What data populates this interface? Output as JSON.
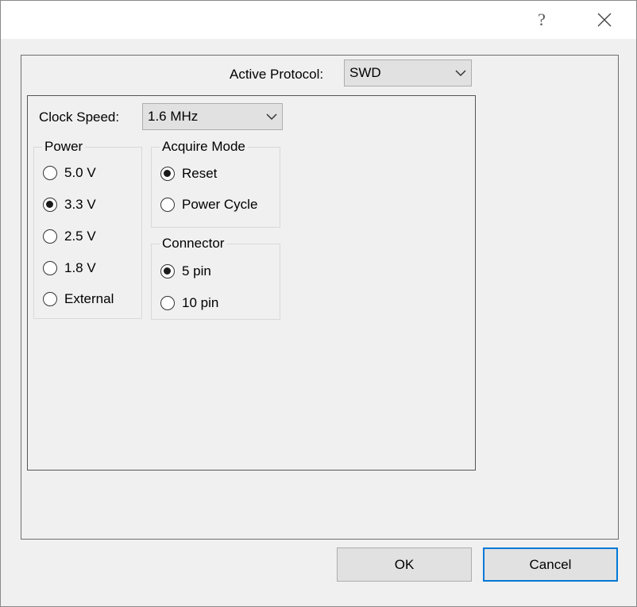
{
  "titlebar": {
    "help_glyph": "?",
    "close_icon": "close-icon"
  },
  "protocol": {
    "label": "Active Protocol:",
    "value": "SWD"
  },
  "clock": {
    "label": "Clock Speed:",
    "value": "1.6 MHz"
  },
  "power": {
    "title": "Power",
    "options": [
      "5.0 V",
      "3.3 V",
      "2.5 V",
      "1.8 V",
      "External"
    ],
    "selected": "3.3 V"
  },
  "acquire": {
    "title": "Acquire Mode",
    "options": [
      "Reset",
      "Power Cycle"
    ],
    "selected": "Reset"
  },
  "connector": {
    "title": "Connector",
    "options": [
      "5 pin",
      "10 pin"
    ],
    "selected": "5 pin"
  },
  "buttons": {
    "ok": "OK",
    "cancel": "Cancel"
  },
  "colors": {
    "focus": "#0078d7",
    "panel": "#f0f0f0"
  }
}
